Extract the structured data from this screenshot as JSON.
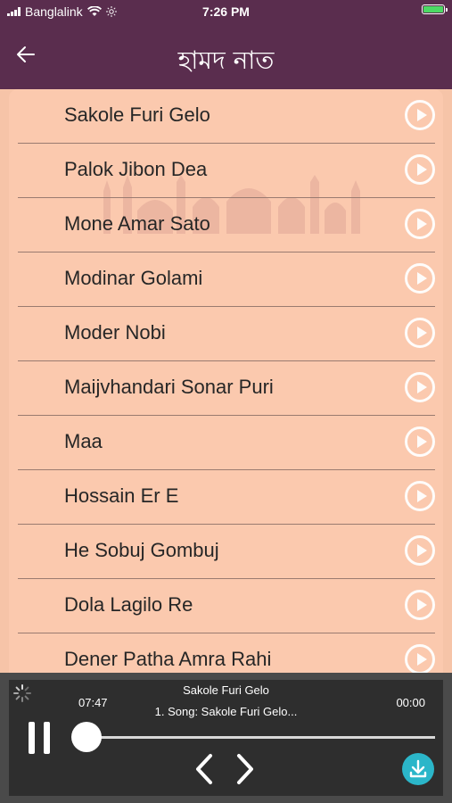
{
  "status": {
    "carrier": "Banglalink",
    "time": "7:26 PM",
    "battery_color": "#4cd964"
  },
  "header": {
    "title": "হামদ নাত",
    "back_icon": "back-arrow-icon"
  },
  "songs": [
    {
      "title": "Sakole Furi Gelo"
    },
    {
      "title": "Palok Jibon Dea"
    },
    {
      "title": "Mone Amar Sato"
    },
    {
      "title": "Modinar Golami"
    },
    {
      "title": "Moder Nobi"
    },
    {
      "title": "Maijvhandari Sonar Puri"
    },
    {
      "title": "Maa"
    },
    {
      "title": "Hossain Er E"
    },
    {
      "title": "He Sobuj Gombuj"
    },
    {
      "title": "Dola Lagilo Re"
    },
    {
      "title": "Dener Patha Amra Rahi"
    }
  ],
  "player": {
    "now_playing": "Sakole Furi Gelo",
    "subtitle": "1. Song: Sakole Furi Gelo...",
    "elapsed": "07:47",
    "remaining": "00:00",
    "progress": 0.0,
    "accent_color": "#2bb6c9"
  },
  "colors": {
    "header_bg": "#5a2d4e",
    "list_bg": "#fbc9ae",
    "player_bg": "#2e2e2e"
  }
}
